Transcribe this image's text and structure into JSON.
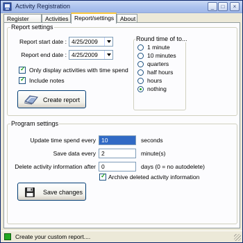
{
  "window": {
    "title": "Activity Registration",
    "controls": {
      "minimize": "_",
      "maximize": "□",
      "close": "×"
    }
  },
  "tabs": [
    {
      "label": "Register time",
      "active": false
    },
    {
      "label": "Activities",
      "active": false
    },
    {
      "label": "Report/settings",
      "active": true
    },
    {
      "label": "About",
      "active": false
    }
  ],
  "report_settings": {
    "group_label": "Report settings",
    "start_date_label": "Report start date :",
    "start_date_value": "4/25/2009",
    "end_date_label": "Report end date :",
    "end_date_value": "4/25/2009",
    "only_display_label": "Only display activities with time spend",
    "only_display_checked": true,
    "include_notes_label": "Include notes",
    "include_notes_checked": true,
    "create_report_label": "Create report",
    "round_time": {
      "label": "Round time of to...",
      "options": [
        "1 minute",
        "10 minutes",
        "quarters",
        "half hours",
        "hours",
        "nothing"
      ],
      "selected": "nothing"
    }
  },
  "program_settings": {
    "group_label": "Program settings",
    "update_label": "Update time spend every",
    "update_value": "10",
    "update_unit": "seconds",
    "save_label": "Save data every",
    "save_value": "2",
    "save_unit": "minute(s)",
    "delete_label": "Delete activity information after",
    "delete_value": "0",
    "delete_unit": "days (0 = no autodelete)",
    "archive_label": "Archive deleted activity information",
    "archive_checked": true,
    "save_changes_label": "Save changes"
  },
  "status": {
    "text": "Create your custom report....",
    "color": "#22a722"
  },
  "colors": {
    "tab_highlight": "#ffc83c",
    "selection": "#316ac5",
    "title_gradient_start": "#c9d8f3"
  }
}
